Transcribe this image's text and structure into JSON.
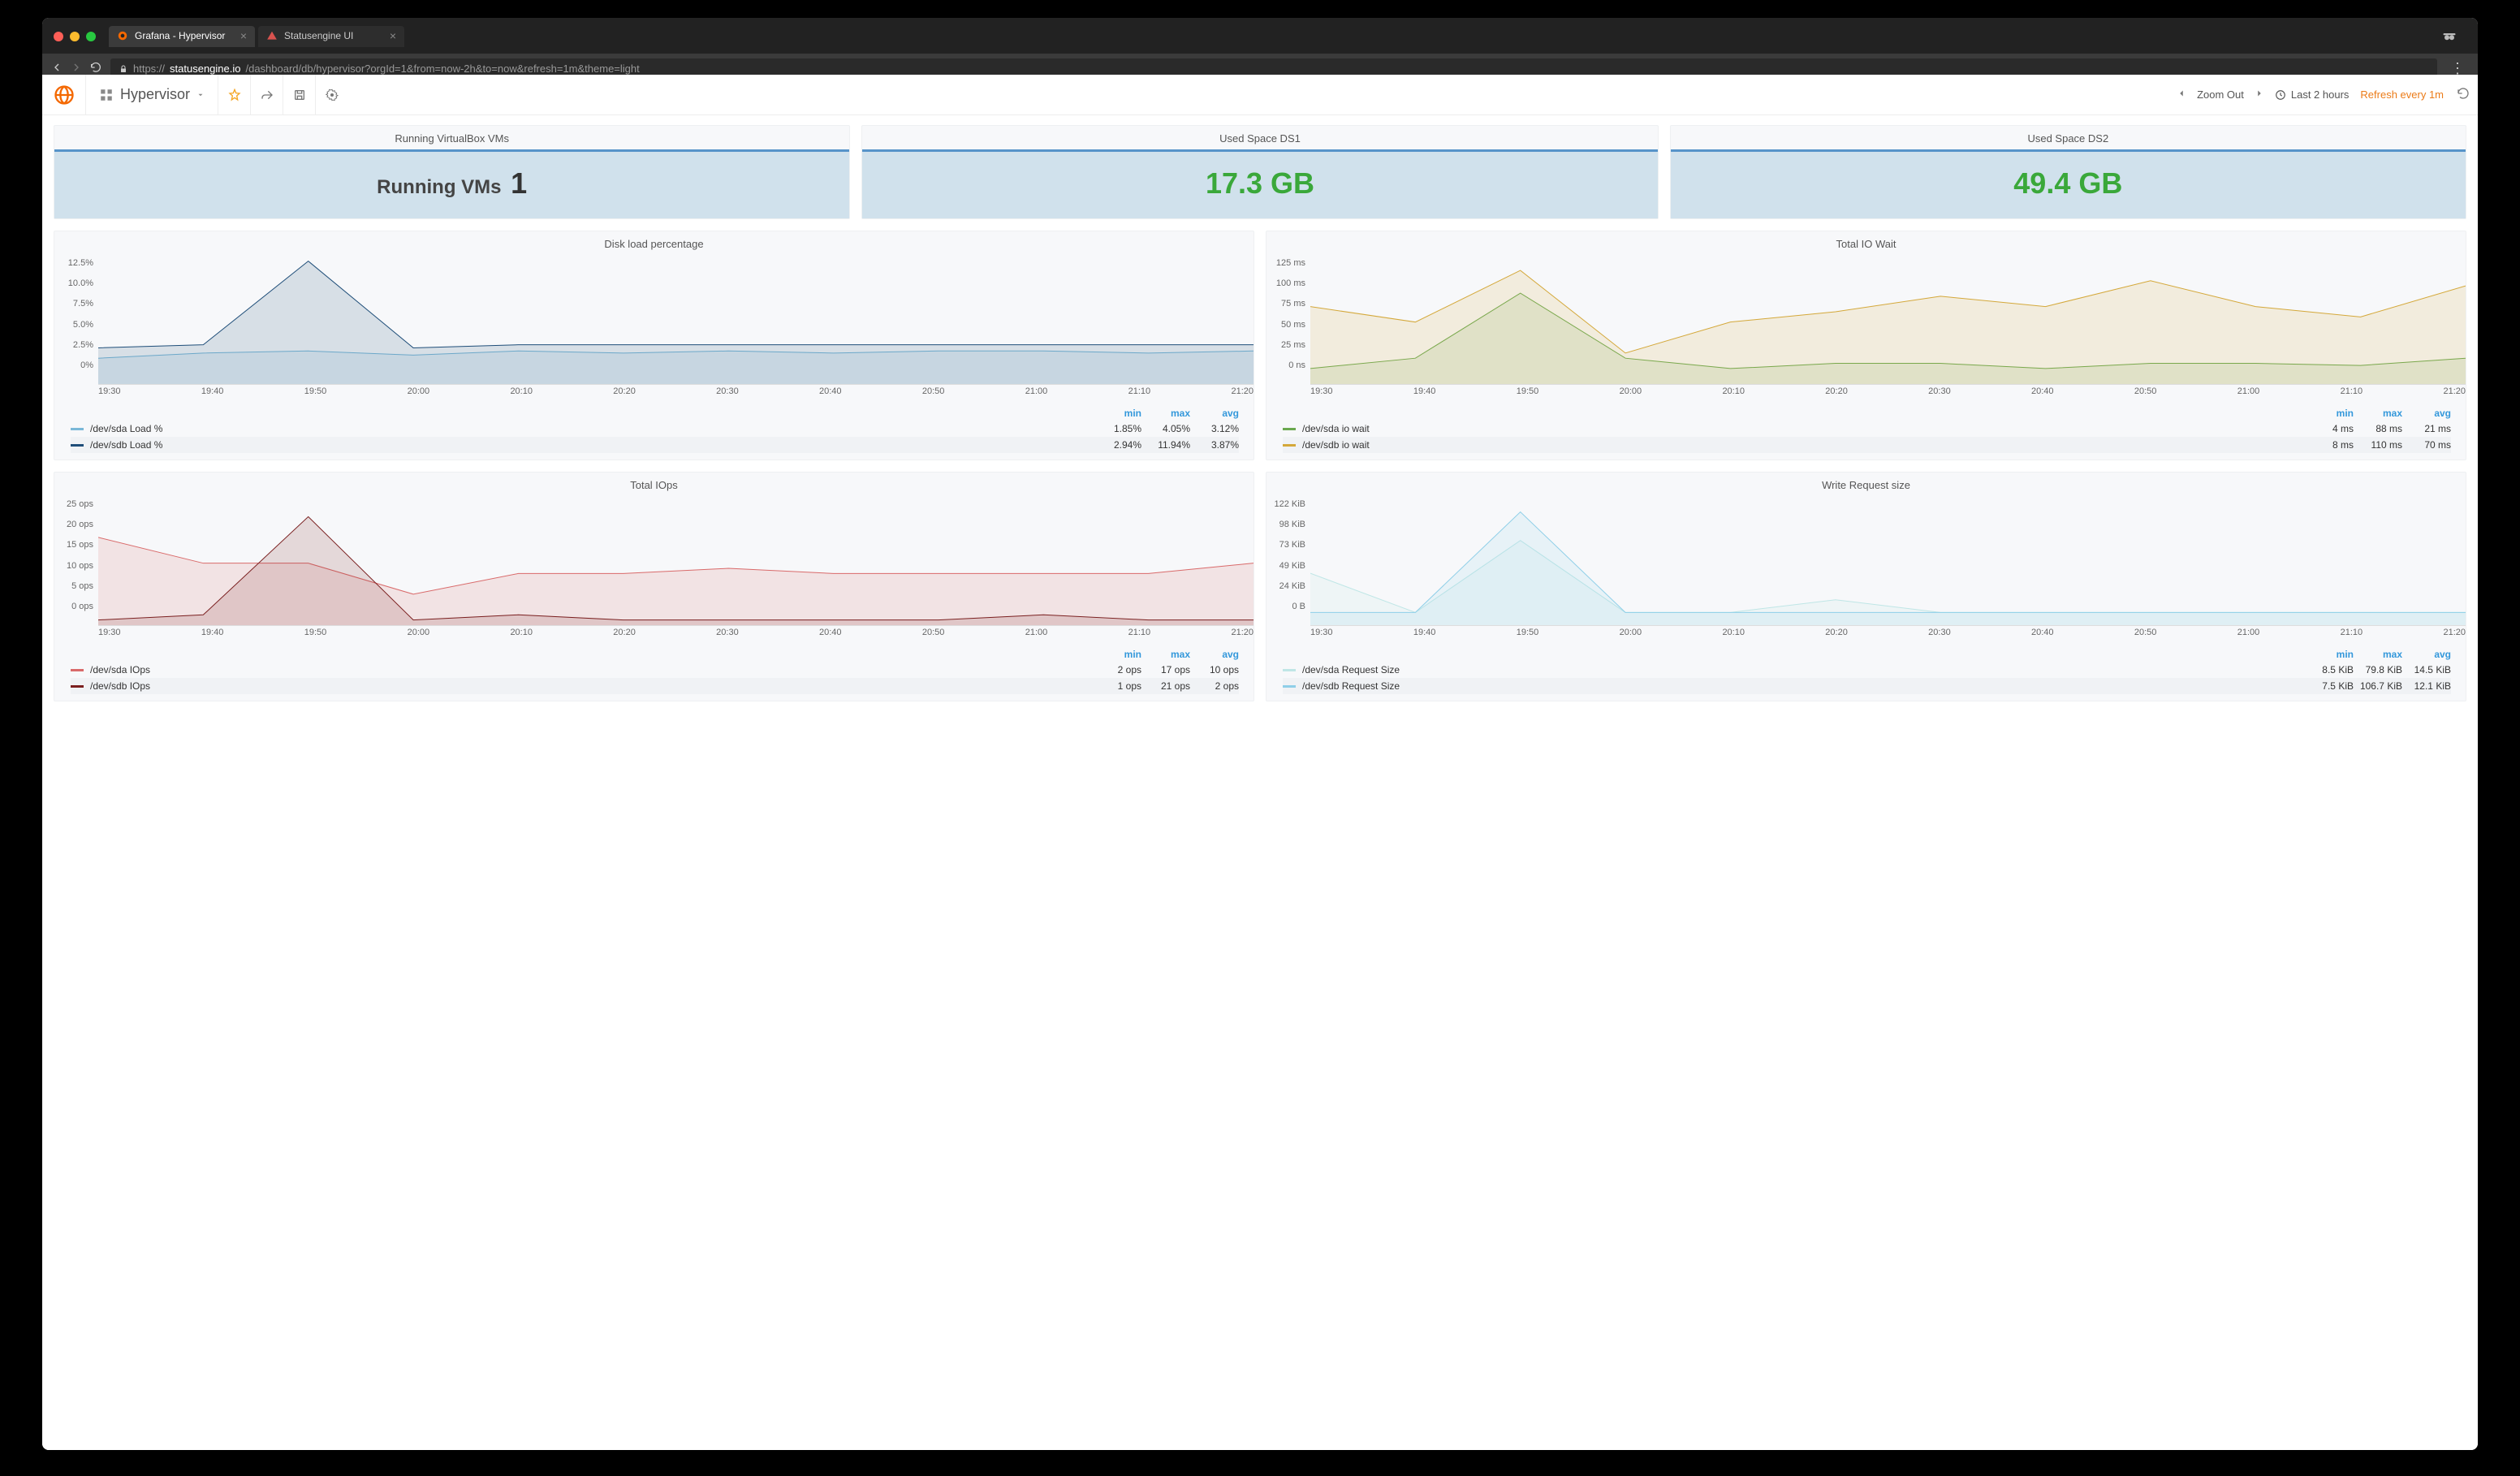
{
  "browser": {
    "tab1": "Grafana - Hypervisor",
    "tab2": "Statusengine UI",
    "url_scheme": "https://",
    "url_host": "statusengine.io",
    "url_path": "/dashboard/db/hypervisor?orgId=1&from=now-2h&to=now&refresh=1m&theme=light"
  },
  "toolbar": {
    "dash_name": "Hypervisor",
    "zoom": "Zoom Out",
    "range": "Last 2 hours",
    "refresh": "Refresh every 1m"
  },
  "stats": {
    "p1_title": "Running VirtualBox VMs",
    "p1_label": "Running VMs",
    "p1_value": "1",
    "p2_title": "Used Space DS1",
    "p2_value": "17.3 GB",
    "p3_title": "Used Space DS2",
    "p3_value": "49.4 GB"
  },
  "xticks": [
    "19:30",
    "19:40",
    "19:50",
    "20:00",
    "20:10",
    "20:20",
    "20:30",
    "20:40",
    "20:50",
    "21:00",
    "21:10",
    "21:20"
  ],
  "legend_hdr": {
    "min": "min",
    "max": "max",
    "avg": "avg"
  },
  "panels": {
    "disk": {
      "title": "Disk load percentage",
      "yticks": [
        "12.5%",
        "10.0%",
        "7.5%",
        "5.0%",
        "2.5%",
        "0%"
      ],
      "s1": {
        "name": "/dev/sda Load %",
        "min": "1.85%",
        "max": "4.05%",
        "avg": "3.12%",
        "color": "#7ab8d8"
      },
      "s2": {
        "name": "/dev/sdb Load %",
        "min": "2.94%",
        "max": "11.94%",
        "avg": "3.87%",
        "color": "#1f4e79"
      }
    },
    "iowait": {
      "title": "Total IO Wait",
      "yticks": [
        "125 ms",
        "100 ms",
        "75 ms",
        "50 ms",
        "25 ms",
        "0 ns"
      ],
      "s1": {
        "name": "/dev/sda io wait",
        "min": "4 ms",
        "max": "88 ms",
        "avg": "21 ms",
        "color": "#6aa84f"
      },
      "s2": {
        "name": "/dev/sdb io wait",
        "min": "8 ms",
        "max": "110 ms",
        "avg": "70 ms",
        "color": "#d4a83a"
      }
    },
    "iops": {
      "title": "Total IOps",
      "yticks": [
        "25 ops",
        "20 ops",
        "15 ops",
        "10 ops",
        "5 ops",
        "0 ops"
      ],
      "s1": {
        "name": "/dev/sda IOps",
        "min": "2 ops",
        "max": "17 ops",
        "avg": "10 ops",
        "color": "#d96a6a"
      },
      "s2": {
        "name": "/dev/sdb IOps",
        "min": "1 ops",
        "max": "21 ops",
        "avg": "2 ops",
        "color": "#7a1f1f"
      }
    },
    "wreq": {
      "title": "Write Request size",
      "yticks": [
        "122 KiB",
        "98 KiB",
        "73 KiB",
        "49 KiB",
        "24 KiB",
        "0 B"
      ],
      "s1": {
        "name": "/dev/sda Request Size",
        "min": "8.5 KiB",
        "max": "79.8 KiB",
        "avg": "14.5 KiB",
        "color": "#bfe6e6"
      },
      "s2": {
        "name": "/dev/sdb Request Size",
        "min": "7.5 KiB",
        "max": "106.7 KiB",
        "avg": "12.1 KiB",
        "color": "#8fcfe8"
      }
    }
  },
  "chart_data": [
    {
      "type": "line",
      "title": "Disk load percentage",
      "ylabel": "%",
      "ylim": [
        0,
        12.5
      ],
      "categories": [
        "19:30",
        "19:40",
        "19:50",
        "20:00",
        "20:10",
        "20:20",
        "20:30",
        "20:40",
        "20:50",
        "21:00",
        "21:10",
        "21:20"
      ],
      "series": [
        {
          "name": "/dev/sda Load %",
          "values": [
            2.5,
            3.0,
            3.2,
            2.8,
            3.2,
            3.0,
            3.2,
            3.0,
            3.2,
            3.2,
            3.0,
            3.2
          ]
        },
        {
          "name": "/dev/sdb Load %",
          "values": [
            3.5,
            3.8,
            11.9,
            3.5,
            3.8,
            3.8,
            3.8,
            3.8,
            3.8,
            3.8,
            3.8,
            3.8
          ]
        }
      ]
    },
    {
      "type": "line",
      "title": "Total IO Wait",
      "ylabel": "ms",
      "ylim": [
        0,
        125
      ],
      "categories": [
        "19:30",
        "19:40",
        "19:50",
        "20:00",
        "20:10",
        "20:20",
        "20:30",
        "20:40",
        "20:50",
        "21:00",
        "21:10",
        "21:20"
      ],
      "series": [
        {
          "name": "/dev/sda io wait",
          "values": [
            15,
            25,
            88,
            25,
            15,
            20,
            20,
            15,
            20,
            20,
            18,
            25
          ]
        },
        {
          "name": "/dev/sdb io wait",
          "values": [
            75,
            60,
            110,
            30,
            60,
            70,
            85,
            75,
            100,
            75,
            65,
            95
          ]
        }
      ]
    },
    {
      "type": "line",
      "title": "Total IOps",
      "ylabel": "ops",
      "ylim": [
        0,
        25
      ],
      "categories": [
        "19:30",
        "19:40",
        "19:50",
        "20:00",
        "20:10",
        "20:20",
        "20:30",
        "20:40",
        "20:50",
        "21:00",
        "21:10",
        "21:20"
      ],
      "series": [
        {
          "name": "/dev/sda IOps",
          "values": [
            17,
            12,
            12,
            6,
            10,
            10,
            11,
            10,
            10,
            10,
            10,
            12
          ]
        },
        {
          "name": "/dev/sdb IOps",
          "values": [
            1,
            2,
            21,
            1,
            2,
            1,
            1,
            1,
            1,
            2,
            1,
            1
          ]
        }
      ]
    },
    {
      "type": "line",
      "title": "Write Request size",
      "ylabel": "KiB",
      "ylim": [
        0,
        122
      ],
      "categories": [
        "19:30",
        "19:40",
        "19:50",
        "20:00",
        "20:10",
        "20:20",
        "20:30",
        "20:40",
        "20:50",
        "21:00",
        "21:10",
        "21:20"
      ],
      "series": [
        {
          "name": "/dev/sda Request Size",
          "values": [
            49,
            12,
            80,
            12,
            12,
            24,
            12,
            12,
            12,
            12,
            12,
            12
          ]
        },
        {
          "name": "/dev/sdb Request Size",
          "values": [
            12,
            12,
            107,
            12,
            12,
            12,
            12,
            12,
            12,
            12,
            12,
            12
          ]
        }
      ]
    }
  ]
}
